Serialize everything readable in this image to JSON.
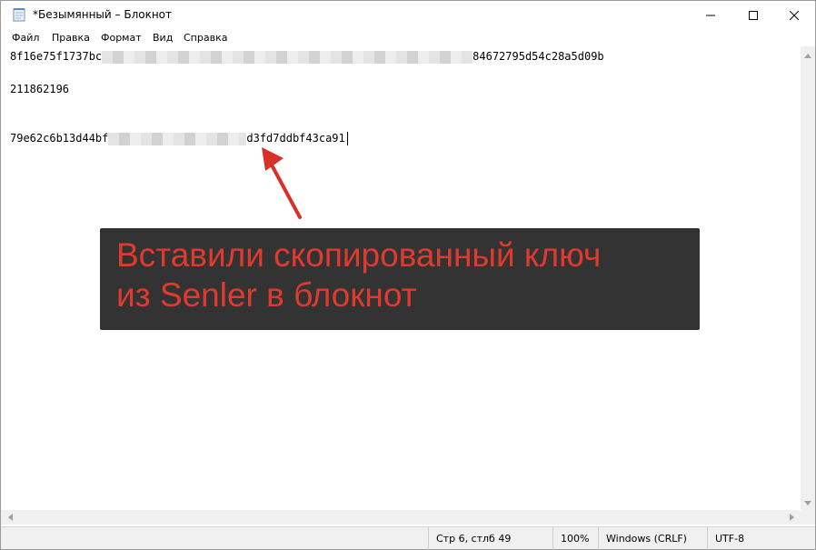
{
  "window": {
    "title": "*Безымянный – Блокнот",
    "icon": "notepad-icon"
  },
  "menu": {
    "items": [
      "Файл",
      "Правка",
      "Формат",
      "Вид",
      "Справка"
    ]
  },
  "editor": {
    "line1_start": "8f16e75f1737bc",
    "line1_end": "84672795d54c28a5d09b",
    "line2": "211862196",
    "line3_start": "79e62c6b13d44bf",
    "line3_end": "d3fd7ddbf43ca91"
  },
  "status": {
    "position": "Стр 6, стлб 49",
    "zoom": "100%",
    "line_ending": "Windows (CRLF)",
    "encoding": "UTF-8"
  },
  "annotation": {
    "line1": "Вставили скопированный ключ",
    "line2": "из Senler в блокнот",
    "text_color": "#e03a2f",
    "bg_color": "#333333",
    "arrow_color": "#d9302a"
  }
}
